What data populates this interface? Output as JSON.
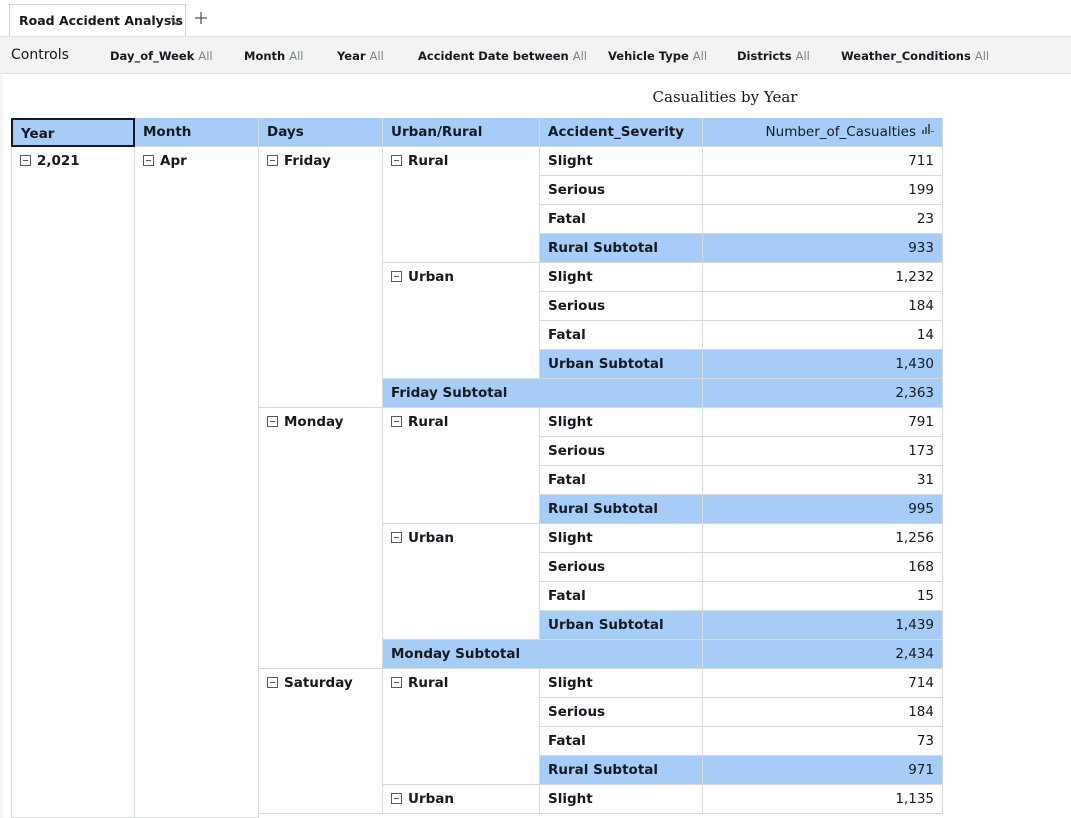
{
  "tabs": [
    {
      "label": "Road Accident Analysis"
    }
  ],
  "controls": {
    "title": "Controls",
    "items": [
      {
        "name": "Day_of_Week",
        "value": "All"
      },
      {
        "name": "Month",
        "value": "All"
      },
      {
        "name": "Year",
        "value": "All"
      },
      {
        "name": "Accident Date between",
        "value": "All"
      },
      {
        "name": "Vehicle Type",
        "value": "All"
      },
      {
        "name": "Districts",
        "value": "All"
      },
      {
        "name": "Weather_Conditions",
        "value": "All"
      }
    ]
  },
  "visual": {
    "title": "Casualities by Year",
    "headers": [
      "Year",
      "Month",
      "Days",
      "Urban/Rural",
      "Accident_Severity",
      "Number_of_Casualties"
    ],
    "year": "2,021",
    "month": "Apr",
    "days": [
      {
        "day": "Friday",
        "groups": [
          {
            "area": "Rural",
            "rows": [
              {
                "severity": "Slight",
                "value": "711"
              },
              {
                "severity": "Serious",
                "value": "199"
              },
              {
                "severity": "Fatal",
                "value": "23"
              }
            ],
            "subtotal_label": "Rural Subtotal",
            "subtotal": "933"
          },
          {
            "area": "Urban",
            "rows": [
              {
                "severity": "Slight",
                "value": "1,232"
              },
              {
                "severity": "Serious",
                "value": "184"
              },
              {
                "severity": "Fatal",
                "value": "14"
              }
            ],
            "subtotal_label": "Urban Subtotal",
            "subtotal": "1,430"
          }
        ],
        "subtotal_label": "Friday Subtotal",
        "subtotal": "2,363"
      },
      {
        "day": "Monday",
        "groups": [
          {
            "area": "Rural",
            "rows": [
              {
                "severity": "Slight",
                "value": "791"
              },
              {
                "severity": "Serious",
                "value": "173"
              },
              {
                "severity": "Fatal",
                "value": "31"
              }
            ],
            "subtotal_label": "Rural Subtotal",
            "subtotal": "995"
          },
          {
            "area": "Urban",
            "rows": [
              {
                "severity": "Slight",
                "value": "1,256"
              },
              {
                "severity": "Serious",
                "value": "168"
              },
              {
                "severity": "Fatal",
                "value": "15"
              }
            ],
            "subtotal_label": "Urban Subtotal",
            "subtotal": "1,439"
          }
        ],
        "subtotal_label": "Monday Subtotal",
        "subtotal": "2,434"
      },
      {
        "day": "Saturday",
        "groups": [
          {
            "area": "Rural",
            "rows": [
              {
                "severity": "Slight",
                "value": "714"
              },
              {
                "severity": "Serious",
                "value": "184"
              },
              {
                "severity": "Fatal",
                "value": "73"
              }
            ],
            "subtotal_label": "Rural Subtotal",
            "subtotal": "971"
          },
          {
            "area": "Urban",
            "rows": [
              {
                "severity": "Slight",
                "value": "1,135"
              }
            ]
          }
        ]
      }
    ]
  },
  "colors": {
    "header_bg": "#a6cdf7",
    "subtotal_bg": "#a6cdf7",
    "controls_bg": "#f2f3f3"
  }
}
